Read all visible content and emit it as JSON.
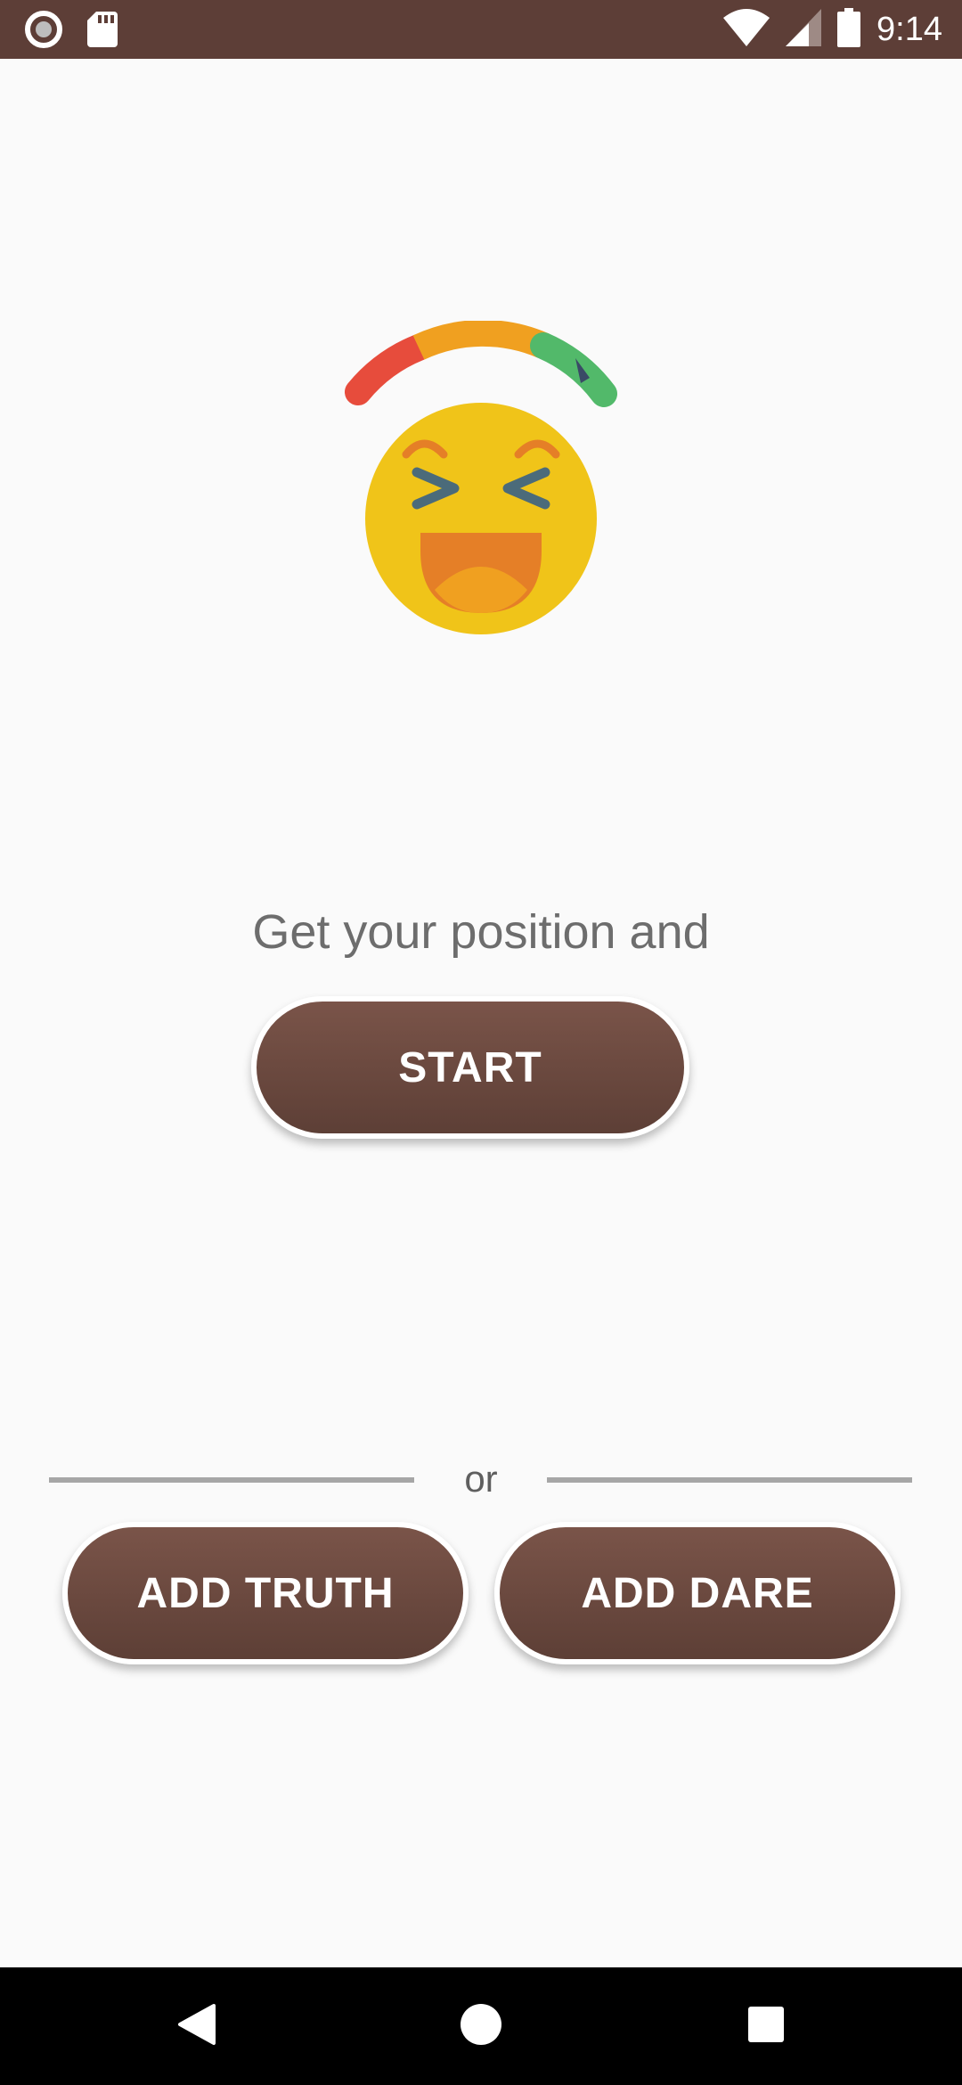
{
  "status_bar": {
    "time": "9:14",
    "left_icons": [
      "media-circle-icon",
      "sd-card-icon"
    ],
    "right_icons": [
      "wifi-icon",
      "cell-signal-icon",
      "battery-icon"
    ],
    "background_color": "#5d3e37"
  },
  "hero": {
    "icon": "laughing-emoji-meter-icon",
    "meter_colors": [
      "#e74c3c",
      "#f0a020",
      "#52b96a",
      "#3a4a66"
    ],
    "face_color": "#f0c419"
  },
  "main": {
    "tagline": "Get your position and",
    "start_label": "START"
  },
  "divider": {
    "text": "or"
  },
  "actions": {
    "add_truth_label": "ADD TRUTH",
    "add_dare_label": "ADD DARE"
  },
  "nav_bar": {
    "items": [
      "back-icon",
      "home-icon",
      "recents-icon"
    ]
  },
  "colors": {
    "button_brown": "#6b4a40",
    "background": "#fafafa"
  }
}
